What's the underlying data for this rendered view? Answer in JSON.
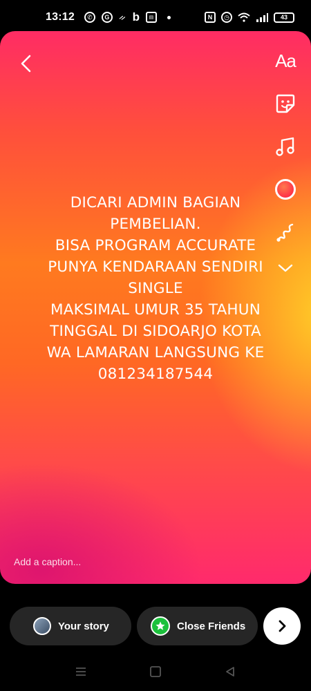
{
  "status_bar": {
    "time": "13:12",
    "battery": "43",
    "app_icons": [
      "whatsapp-icon",
      "g-icon",
      "snapchat-icon",
      "b-icon",
      "news-icon"
    ],
    "system_icons": [
      "nfc-icon",
      "alarm-icon",
      "wifi-icon",
      "signal-icon",
      "battery-icon"
    ]
  },
  "story": {
    "text_lines": [
      "DICARI ADMIN BAGIAN",
      "PEMBELIAN.",
      "BISA PROGRAM ACCURATE",
      "PUNYA KENDARAAN SENDIRI",
      "SINGLE",
      "MAKSIMAL UMUR 35 TAHUN",
      "TINGGAL DI SIDOARJO KOTA",
      "WA LAMARAN LANGSUNG KE",
      "081234187544"
    ],
    "tools": {
      "text_label": "Aa",
      "icons": [
        "text-tool-icon",
        "sticker-icon",
        "music-icon",
        "color-picker-icon",
        "draw-icon",
        "chevron-down-icon"
      ]
    },
    "caption_placeholder": "Add a caption..."
  },
  "share": {
    "your_story": "Your story",
    "close_friends": "Close Friends"
  },
  "colors": {
    "close_friends_green": "#1cc13c",
    "pill_bg": "#262626"
  }
}
